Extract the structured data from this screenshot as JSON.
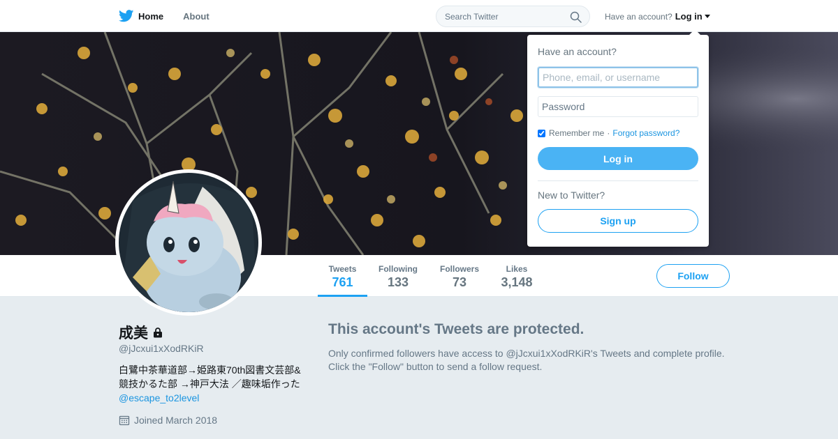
{
  "nav": {
    "home_label": "Home",
    "about_label": "About",
    "search_placeholder": "Search Twitter",
    "have_account": "Have an account?",
    "login_label": "Log in"
  },
  "stats": [
    {
      "label": "Tweets",
      "value": "761"
    },
    {
      "label": "Following",
      "value": "133"
    },
    {
      "label": "Followers",
      "value": "73"
    },
    {
      "label": "Likes",
      "value": "3,148"
    }
  ],
  "follow_label": "Follow",
  "profile": {
    "name": "成美",
    "screen_name": "@jJcxui1xXodRKiR",
    "bio_text": "白鷺中茶華道部→姫路東70th図書文芸部&競技かるた部 →神戸大法 ／趣味垢作った",
    "bio_link": "@escape_to2level",
    "joined": "Joined March 2018"
  },
  "protected": {
    "title": "This account's Tweets are protected.",
    "text": "Only confirmed followers have access to @jJcxui1xXodRKiR's Tweets and complete profile. Click the \"Follow\" button to send a follow request."
  },
  "login_dropdown": {
    "heading": "Have an account?",
    "username_placeholder": "Phone, email, or username",
    "password_placeholder": "Password",
    "remember_label": "Remember me",
    "separator": "·",
    "forgot_label": "Forgot password?",
    "login_button": "Log in",
    "new_label": "New to Twitter?",
    "signup_button": "Sign up"
  },
  "colors": {
    "accent": "#1da1f2",
    "login_button": "#4ab3f4",
    "background": "#e6ecf0"
  }
}
